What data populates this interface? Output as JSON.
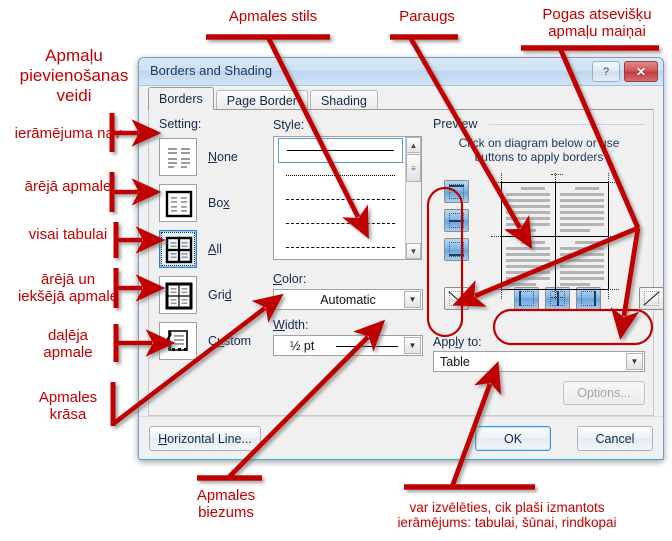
{
  "dialog": {
    "title": "Borders and Shading",
    "help_button": "?",
    "close_button": "✕",
    "tabs": [
      {
        "label": "Borders",
        "accel": "B",
        "active": true
      },
      {
        "label": "Page Border",
        "accel": "P",
        "active": false
      },
      {
        "label": "Shading",
        "accel": "S",
        "active": false
      }
    ],
    "setting": {
      "label": "Setting:",
      "options": [
        {
          "label": "None",
          "accel": "N",
          "selected": false
        },
        {
          "label": "Box",
          "accel": "x",
          "selected": false
        },
        {
          "label": "All",
          "accel": "A",
          "selected": true
        },
        {
          "label": "Grid",
          "accel": "G",
          "selected": false
        },
        {
          "label": "Custom",
          "accel": "u",
          "selected": false
        }
      ]
    },
    "style": {
      "label": "Style:",
      "items": [
        "solid",
        "dotted",
        "dashed-long",
        "dashed-short",
        "dash-dot"
      ],
      "selected_index": 0
    },
    "color": {
      "label": "Color:",
      "value": "Automatic"
    },
    "width": {
      "label": "Width:",
      "value": "½ pt"
    },
    "preview": {
      "legend": "Preview",
      "hint_line1": "Click on diagram below or use",
      "hint_line2": "buttons to apply borders",
      "side_buttons": [
        "top-border-button",
        "middle-horizontal-border-button",
        "bottom-border-button",
        "diagonal-down-border-button"
      ],
      "bottom_buttons": [
        "left-border-button",
        "middle-vertical-border-button",
        "right-border-button",
        "diagonal-up-border-button"
      ]
    },
    "apply_to": {
      "label": "Apply to:",
      "value": "Table"
    },
    "options_button": "Options...",
    "footer": {
      "horizontal_line": "Horizontal Line...",
      "ok": "OK",
      "cancel": "Cancel"
    }
  },
  "annotations": {
    "accent_color": "#C00000",
    "title_top_left": "Apmaļu\npievienošanas\nveidi",
    "left_items": [
      "ierāmējuma nav",
      "ārējā apmale",
      "visai tabulai",
      "ārējā un\niekšējā apmale",
      "daļēja\napmale",
      "Apmales\nkrāsa"
    ],
    "top_style": "Apmales stils",
    "top_preview": "Paraugs",
    "top_buttons": "Pogas atsevišķu\napmaļu maiņai",
    "bottom_width": "Apmales\nbiezums",
    "bottom_apply": "var izvēlēties, cik plaši izmantots\nierāmējums: tabulai, šūnai, rindkopai"
  }
}
